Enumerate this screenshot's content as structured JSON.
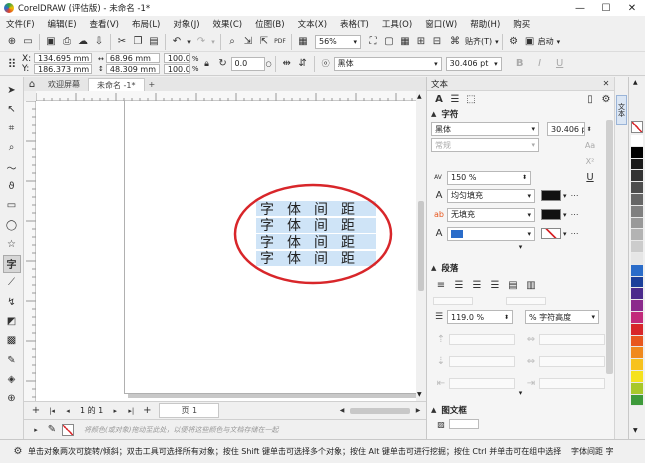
{
  "window": {
    "title": "CorelDRAW (评估版) - 未命名 -1*",
    "min": "—",
    "max": "☐",
    "close": "✕"
  },
  "menu": [
    "文件(F)",
    "编辑(E)",
    "查看(V)",
    "布局(L)",
    "对象(J)",
    "效果(C)",
    "位图(B)",
    "文本(X)",
    "表格(T)",
    "工具(O)",
    "窗口(W)",
    "帮助(H)",
    "购买"
  ],
  "toolbar": {
    "zoom": "56%",
    "snap_label": "贴齐(T)",
    "launch_label": "启动"
  },
  "propbar": {
    "x_label": "X:",
    "x": "134.695 mm",
    "y_label": "Y:",
    "y": "186.373 mm",
    "w": "68.96 mm",
    "h": "48.309 mm",
    "sx": "100.0",
    "sy": "100.0",
    "pct": "%",
    "angle": "0.0",
    "degree": "○",
    "font": "黑体",
    "size": "30.406 pt",
    "bold": "B",
    "italic": "I",
    "underline": "U"
  },
  "tabs": {
    "welcome": "欢迎屏幕",
    "doc": "未命名 -1*",
    "add": "+"
  },
  "canvas": {
    "chars": [
      "字",
      "体",
      "间",
      "距"
    ],
    "lines": 4
  },
  "pagebar": {
    "page_counter": "1 的 1",
    "page_tab": "页 1"
  },
  "colorbar": {
    "hint": "将颜色(或对象)拖动至此处，以便将这些颜色与文档存储在一起"
  },
  "docker": {
    "title": "文本",
    "char_section": "字符",
    "font": "黑体",
    "style": "常规",
    "size": "30.406 pt",
    "kerning_label": "AV",
    "kerning": "150 %",
    "fill_type": "均匀填充",
    "bg_fill": "无填充",
    "outline_label": "A",
    "para_section": "段落",
    "line_spacing": "119.0 %",
    "line_unit": "% 字符高度",
    "frame_section": "图文框"
  },
  "status": {
    "hint": "单击对象两次可旋转/倾斜；双击工具可选择所有对象；按住 Shift 键单击可选择多个对象；按住 Alt 键单击可进行挖掘；按住 Ctrl 并单击可在组中选择",
    "right": "字体间距 字"
  },
  "colors": {
    "accent_red": "#d8262a",
    "text_highlight": "#cfe4f7",
    "palette": [
      "#ffffff",
      "#000000",
      "#1a1a1a",
      "#333333",
      "#4d4d4d",
      "#666666",
      "#808080",
      "#999999",
      "#b3b3b3",
      "#cccccc",
      "#e6e6e6",
      "#2a6cc9",
      "#1b3f9a",
      "#4b2a8c",
      "#8b2a8c",
      "#c22a7a",
      "#d8262a",
      "#e8571e",
      "#f08a1e",
      "#f7c21e",
      "#f5e21e",
      "#a8c82a",
      "#3e9a3a",
      "#1e8a6a",
      "#1ea0c8",
      "#8a6a4a",
      "#b38a6a",
      "#d8b890",
      "#c8b8d8",
      "#9a9ab8",
      "#6a7a9a"
    ]
  }
}
